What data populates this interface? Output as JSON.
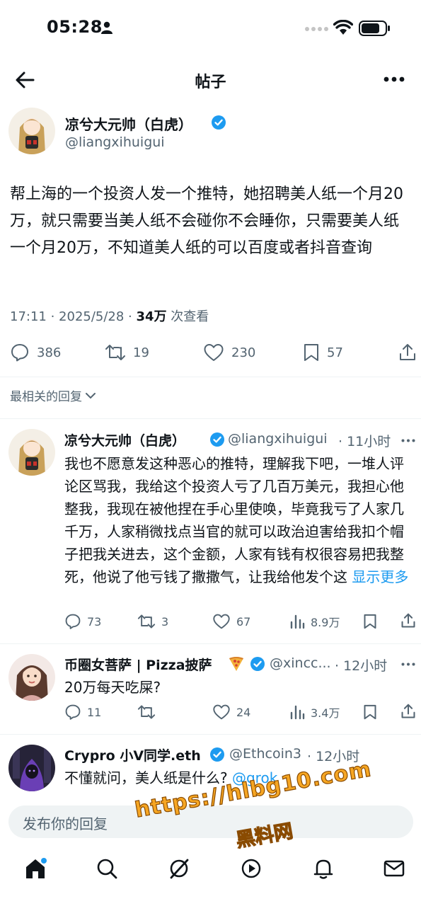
{
  "status_bar": {
    "time": "05:28"
  },
  "header": {
    "title": "帖子"
  },
  "post": {
    "author": "凉兮大元帅（白虎）",
    "handle": "@liangxihuigui",
    "body": "帮上海的一个投资人发一个推特，她招聘美人纸一个月20万，就只需要当美人纸不会碰你不会睡你，只需要美人纸一个月20万，不知道美人纸的可以百度或者抖音查询",
    "time_date": "17:11 · 2025/5/28 · ",
    "views_count": "34万",
    "views_label": " 次查看",
    "stats": {
      "replies": "386",
      "reposts": "19",
      "likes": "230",
      "bookmarks": "57"
    }
  },
  "sort": {
    "label": "最相关的回复"
  },
  "replies": [
    {
      "author": "凉兮大元帅（白虎）",
      "handle": "@liangxihuigui",
      "time": "· 11小时",
      "body": "我也不愿意发这种恶心的推特，理解我下吧，一堆人评论区骂我，我给这个投资人亏了几百万美元，我担心他整我，我现在被他捏在手心里使唤，毕竟我亏了人家几千万，人家稍微找点当官的就可以政治迫害给我扣个帽子把我关进去，这个金额，人家有钱有权很容易把我整死，他说了他亏钱了撒撒气，让我给他发个这",
      "show_more": "显示更多",
      "stats": {
        "replies": "73",
        "reposts": "3",
        "likes": "67",
        "views": "8.9万"
      }
    },
    {
      "author": "币圈女菩萨 | Pizza披萨",
      "handle": "@xincc...",
      "time": "· 12小时",
      "body": "20万每天吃屎?",
      "stats": {
        "replies": "11",
        "reposts": "",
        "likes": "24",
        "views": "3.4万"
      }
    },
    {
      "author": "Crypro 小V同学.eth",
      "handle": "@Ethcoin3",
      "time": "· 12小时",
      "body": "不懂就问，美人纸是什么? ",
      "mention": "@grok"
    }
  ],
  "composer": {
    "placeholder": "发布你的回复"
  },
  "watermark": {
    "line1": "https://hlbg10.com",
    "line2": "黑料网"
  },
  "colors": {
    "accent": "#1d9bf0",
    "text": "#0f1419",
    "muted": "#536471",
    "watermark": "#f6a623"
  },
  "icons": {
    "nav": [
      "home-icon",
      "search-icon",
      "grok-icon",
      "spaces-icon",
      "notifications-icon",
      "messages-icon"
    ]
  }
}
